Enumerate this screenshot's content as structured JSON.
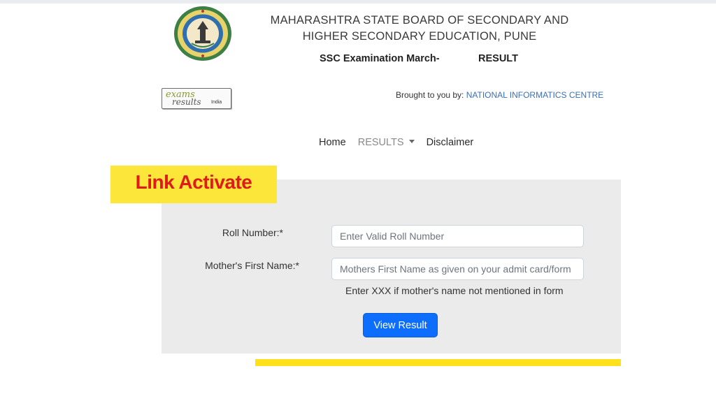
{
  "header": {
    "seal_icon": "board-seal-icon",
    "board_line1": "MAHARASHTRA STATE BOARD OF SECONDARY AND",
    "board_line2": "HIGHER SECONDARY EDUCATION, PUNE",
    "exam_name": "SSC Examination March-",
    "exam_result": "RESULT"
  },
  "branding": {
    "logo_word1": "exams",
    "logo_word2": "results",
    "logo_word3": "India",
    "brought_prefix": "Brought to you by: ",
    "brought_org": "NATIONAL INFORMATICS CENTRE",
    "org_color": "#3b6fb6"
  },
  "nav": {
    "home": "Home",
    "results": "RESULTS",
    "disclaimer": "Disclaimer"
  },
  "badge": {
    "text": "Link Activate",
    "bg_color": "#fde63a",
    "text_color": "#e0191a"
  },
  "form": {
    "roll_label": "Roll Number:*",
    "roll_value": "",
    "roll_placeholder": "Enter Valid Roll Number",
    "mother_label": "Mother's First Name:*",
    "mother_value": "",
    "mother_placeholder": "Mothers First Name as given on your admit card/form",
    "mother_hint": "Enter XXX if mother's name not mentioned in form",
    "submit_label": "View Result",
    "submit_color": "#0d6efd"
  }
}
